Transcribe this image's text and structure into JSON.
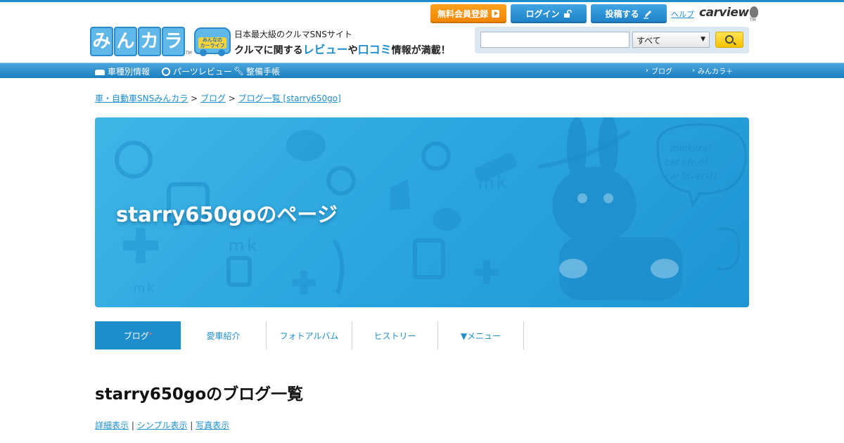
{
  "header": {
    "logo_chars": [
      "み",
      "ん",
      "カ",
      "ラ"
    ],
    "logo_tm": "TM",
    "sub_logo_line1": "みんなの",
    "sub_logo_line2": "カーライフ",
    "tagline_top": "日本最大級のクルマSNSサイト",
    "tagline_a": "クルマに関する",
    "tagline_review": "レビュー",
    "tagline_ya": "や",
    "tagline_kuchikomi": "口コミ",
    "tagline_b": "情報が満載！",
    "buttons": {
      "register": "無料会員登録",
      "login": "ログイン",
      "post": "投稿する"
    },
    "help": "ヘルプ",
    "carview": "carview",
    "carview_tm": "TM"
  },
  "search": {
    "query": "",
    "placeholder": "",
    "category": "すべて"
  },
  "nav": {
    "left": [
      "車種別情報",
      "パーツレビュー",
      "整備手帳"
    ],
    "right": [
      "ブログ",
      "みんカラ＋"
    ]
  },
  "breadcrumb": {
    "items": [
      "車・自動車SNSみんカラ",
      "ブログ",
      "ブログ一覧 [starry650go]"
    ],
    "sep": ">"
  },
  "banner": {
    "title": "starry650goのページ",
    "speech_text": [
      "minkara!",
      "car life of",
      "car lovers!!"
    ]
  },
  "tabs": [
    {
      "label": "ブログ",
      "active": true,
      "marker": "*"
    },
    {
      "label": "愛車紹介",
      "active": false
    },
    {
      "label": "フォトアルバム",
      "active": false
    },
    {
      "label": "ヒストリー",
      "active": false
    },
    {
      "label": "▼メニュー",
      "active": false
    }
  ],
  "main": {
    "heading": "starry650goのブログ一覧",
    "view_modes": [
      "詳細表示",
      "シンプル表示",
      "写真表示"
    ],
    "view_sep": "|"
  },
  "colors": {
    "brand_blue": "#1d8ecb",
    "orange": "#f08300",
    "search_yellow": "#f5c400"
  }
}
